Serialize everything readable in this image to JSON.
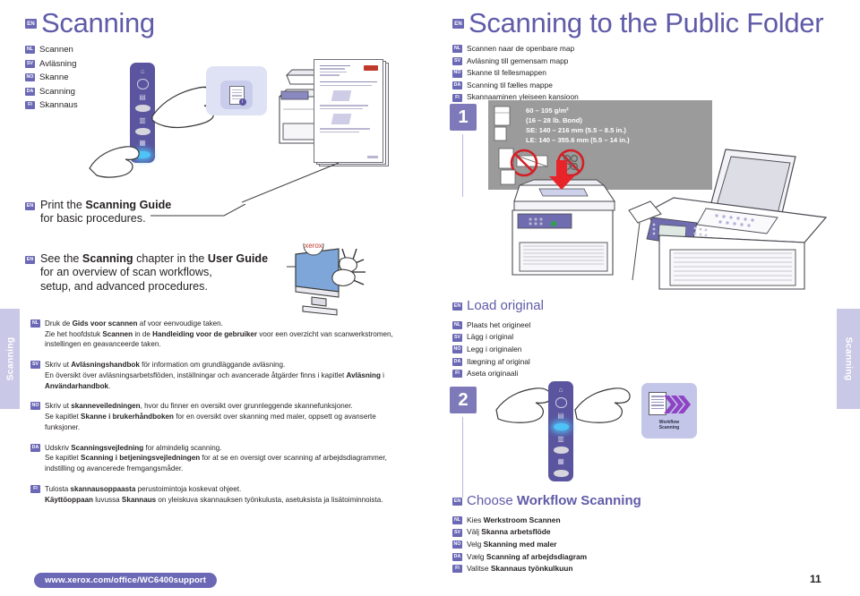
{
  "document": {
    "page_number": "11",
    "footer_url": "www.xerox.com/office/WC6400support",
    "side_tab_label": "Scanning"
  },
  "left": {
    "heading": {
      "badge": "EN",
      "title": "Scanning",
      "translations": [
        {
          "badge": "NL",
          "text": "Scannen"
        },
        {
          "badge": "SV",
          "text": "Avläsning"
        },
        {
          "badge": "NO",
          "text": "Skanne"
        },
        {
          "badge": "DA",
          "text": "Scanning"
        },
        {
          "badge": "FI",
          "text": "Skannaus"
        }
      ]
    },
    "callouts": [
      {
        "badge": "EN",
        "line1_pre": "Print the ",
        "line1_bold": "Scanning Guide",
        "line1_post": "",
        "line2": "for basic procedures."
      },
      {
        "badge": "EN",
        "line1_pre": "See the ",
        "line1_bold": "Scanning",
        "line1_mid": " chapter in the ",
        "line1_bold2": "User Guide",
        "line2": "for an overview of scan workflows,",
        "line3": "setup, and advanced procedures."
      }
    ],
    "paragraphs": [
      {
        "badge": "NL",
        "head": [
          {
            "t": "Druk de ",
            "b": false
          },
          {
            "t": "Gids voor scannen",
            "b": true
          },
          {
            "t": "  af voor eenvoudige taken.",
            "b": false
          }
        ],
        "sub": [
          {
            "t": "Zie het hoofdstuk ",
            "b": false
          },
          {
            "t": "Scannen",
            "b": true
          },
          {
            "t": " in de ",
            "b": false
          },
          {
            "t": "Handleiding voor de gebruiker",
            "b": true
          },
          {
            "t": " voor een overzicht van scanwerkstromen, instellingen en geavanceerde taken.",
            "b": false
          }
        ]
      },
      {
        "badge": "SV",
        "head": [
          {
            "t": "Skriv ut ",
            "b": false
          },
          {
            "t": "Avläsningshandbok",
            "b": true
          },
          {
            "t": " för information om grundläggande avläsning.",
            "b": false
          }
        ],
        "sub": [
          {
            "t": "En översikt över avläsningsarbetsflöden, inställningar och avancerade åtgärder finns i kapitlet ",
            "b": false
          },
          {
            "t": "Avläsning",
            "b": true
          },
          {
            "t": " i ",
            "b": false
          },
          {
            "t": "Användarhandbok",
            "b": true
          },
          {
            "t": ".",
            "b": false
          }
        ]
      },
      {
        "badge": "NO",
        "head": [
          {
            "t": "Skriv ut ",
            "b": false
          },
          {
            "t": "skanneveiledningen",
            "b": true
          },
          {
            "t": ", hvor du finner en oversikt over grunnleggende skannefunksjoner.",
            "b": false
          }
        ],
        "sub": [
          {
            "t": "Se kapitlet ",
            "b": false
          },
          {
            "t": "Skanne i brukerhåndboken",
            "b": true
          },
          {
            "t": " for en oversikt over skanning med maler, oppsett og avanserte funksjoner.",
            "b": false
          }
        ]
      },
      {
        "badge": "DA",
        "head": [
          {
            "t": "Udskriv ",
            "b": false
          },
          {
            "t": "Scanningsvejledning",
            "b": true
          },
          {
            "t": " for almindelig scanning.",
            "b": false
          }
        ],
        "sub": [
          {
            "t": "Se kapitlet ",
            "b": false
          },
          {
            "t": "Scanning i betjeningsvejledningen",
            "b": true
          },
          {
            "t": " for at se en oversigt over scanning af arbejdsdiagrammer, indstilling og avancerede fremgangsmåder.",
            "b": false
          }
        ]
      },
      {
        "badge": "FI",
        "head": [
          {
            "t": "Tulosta ",
            "b": false
          },
          {
            "t": "skannausoppaasta",
            "b": true
          },
          {
            "t": " perustoimintoja koskevat ohjeet.",
            "b": false
          }
        ],
        "sub": [
          {
            "t": "Käyttöoppaan",
            "b": true
          },
          {
            "t": " luvussa ",
            "b": false
          },
          {
            "t": "Skannaus",
            "b": true
          },
          {
            "t": " on yleiskuva skannauksen työnkulusta, asetuksista ja lisätoiminnoista.",
            "b": false
          }
        ]
      }
    ]
  },
  "right": {
    "heading": {
      "badge": "EN",
      "title": "Scanning to the Public Folder",
      "translations": [
        {
          "badge": "NL",
          "text": "Scannen naar de openbare map"
        },
        {
          "badge": "SV",
          "text": "Avläsning till gemensam mapp"
        },
        {
          "badge": "NO",
          "text": "Skanne til fellesmappen"
        },
        {
          "badge": "DA",
          "text": "Scanning til fælles mappe"
        },
        {
          "badge": "FI",
          "text": "Skannaaminen yleiseen kansioon"
        }
      ]
    },
    "step1": {
      "number": "1",
      "spec_lines": [
        "60 – 105 g/m²",
        "(16 – 28 lb. Bond)",
        "SE: 140 – 216 mm (5.5 – 8.5 in.)",
        "LE: 140 – 355.6 mm (5.5 – 14 in.)"
      ],
      "heading": {
        "badge": "EN",
        "title": "Load original",
        "translations": [
          {
            "badge": "NL",
            "text": "Plaats het origineel"
          },
          {
            "badge": "SV",
            "text": "Lägg i original"
          },
          {
            "badge": "NO",
            "text": "Legg i originalen"
          },
          {
            "badge": "DA",
            "text": "Ilægning af original"
          },
          {
            "badge": "FI",
            "text": "Aseta originaali"
          }
        ]
      }
    },
    "step2": {
      "number": "2",
      "tile_label_line1": "Workflow",
      "tile_label_line2": "Scanning",
      "heading": {
        "badge": "EN",
        "title_pre": "Choose ",
        "title_bold": "Workflow Scanning",
        "translations": [
          {
            "badge": "NL",
            "pre": "Kies ",
            "bold": "Werkstroom Scannen"
          },
          {
            "badge": "SV",
            "pre": "Välj ",
            "bold": "Skanna arbetsflöde"
          },
          {
            "badge": "NO",
            "pre": "Velg ",
            "bold": "Skanning med maler"
          },
          {
            "badge": "DA",
            "pre": "Vælg ",
            "bold": "Scanning af arbejdsdiagram"
          },
          {
            "badge": "FI",
            "pre": "Valitse ",
            "bold": "Skannaus työnkulkuun"
          }
        ]
      }
    }
  },
  "colors": {
    "accent_purple": "#5f5ba8",
    "badge_purple": "#6b68b5",
    "step_purple": "#7e7ab9",
    "tab_lavender": "#c9c8e6",
    "spec_grey": "#9b9b9b",
    "red_arrow": "#e8232a"
  }
}
